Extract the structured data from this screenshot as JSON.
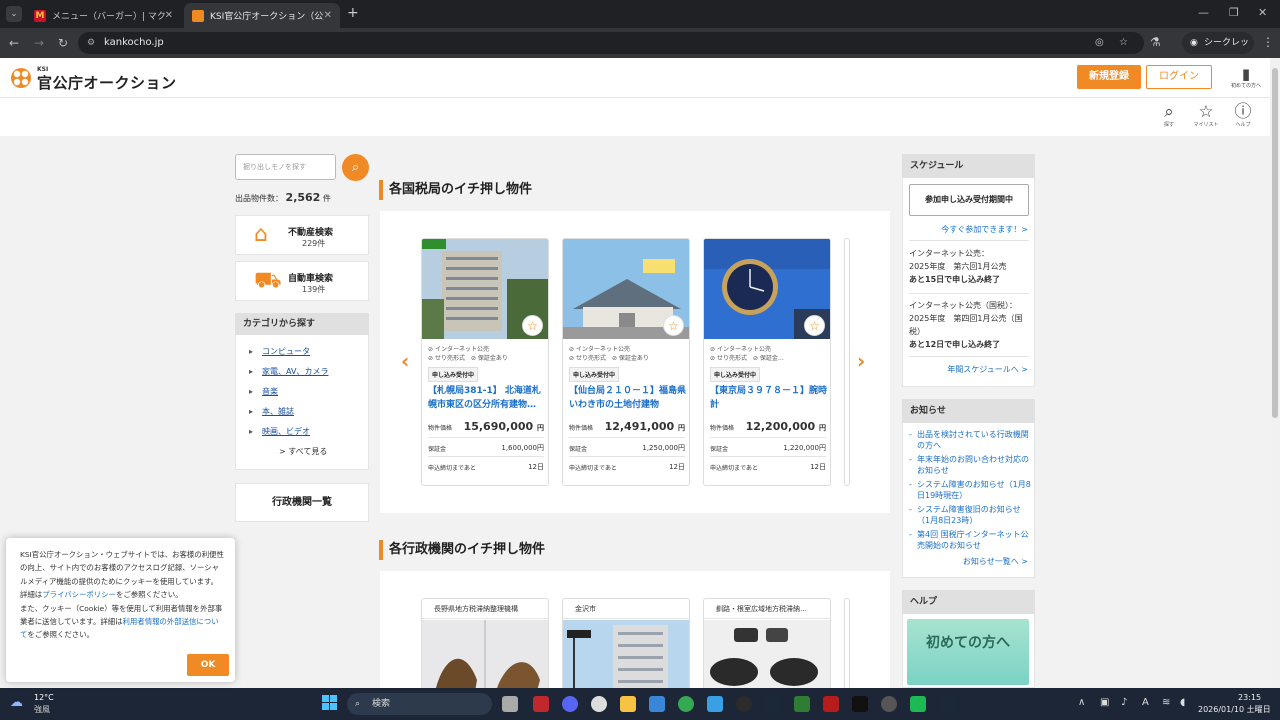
{
  "browser": {
    "tabs": [
      {
        "title": "メニュー（バーガー）| マクドナルド公式",
        "active": false
      },
      {
        "title": "KSI官公庁オークション（公売・公有...",
        "active": true
      }
    ],
    "url": "kankocho.jp",
    "incognito_label": "シークレット"
  },
  "header": {
    "logo_small": "KSI",
    "logo_text": "官公庁オークション",
    "register": "新規登録",
    "login": "ログイン",
    "beginner": "初めての方へ",
    "icons": [
      {
        "label": "探す",
        "icon": "search-icon"
      },
      {
        "label": "マイリスト",
        "icon": "star-icon"
      },
      {
        "label": "ヘルプ",
        "icon": "help-icon"
      }
    ]
  },
  "left": {
    "search_placeholder": "掘り出しモノを探す",
    "count_label": "出品物件数：",
    "count_value": "2,562",
    "count_unit": "件",
    "realestate": {
      "title": "不動産検索",
      "count": "229件"
    },
    "car": {
      "title": "自動車検索",
      "count": "139件"
    },
    "category_head": "カテゴリから探す",
    "categories": [
      "コンピュータ",
      "家電、AV、カメラ",
      "音楽",
      "本、雑誌",
      "映画、ビデオ"
    ],
    "see_all": "> すべて見る",
    "gov_list": "行政機関一覧"
  },
  "center": {
    "section1_title": "各国税局のイチ押し物件",
    "section2_title": "各行政機関のイチ押し物件",
    "labels": {
      "price": "物件価格",
      "deposit": "保証金",
      "deadline": "申込締切まであと",
      "yen": "円"
    },
    "cards": [
      {
        "tag1": "インターネット公売",
        "tag2": "せり売形式",
        "tag3": "保証金あり",
        "badge": "申し込み受付中",
        "name": "【札幌局381-1】 北海道札幌市東区の区分所有建物…",
        "price": "15,690,000",
        "deposit": "1,600,000円",
        "deadline": "12日"
      },
      {
        "tag1": "インターネット公売",
        "tag2": "せり売形式",
        "tag3": "保証金あり",
        "badge": "申し込み受付中",
        "name": "【仙台局２１０－１】福島県いわき市の土地付建物",
        "price": "12,491,000",
        "deposit": "1,250,000円",
        "deadline": "12日"
      },
      {
        "tag1": "インターネット公売",
        "tag2": "せり売形式",
        "tag3": "保証金…",
        "badge": "申し込み受付中",
        "name": "【東京局３９７８－１】腕時計",
        "price": "12,200,000",
        "deposit": "1,220,000円",
        "deadline": "12日"
      }
    ],
    "cards2": [
      "長野県地方税滞納整理機構",
      "金沢市",
      "釧路・根室広域地方税滞納…"
    ]
  },
  "right": {
    "schedule_head": "スケジュール",
    "join_button": "参加申し込み受付期間中",
    "join_link": "今すぐ参加できます！>",
    "s1_line1": "インターネット公売：",
    "s1_line2": "2025年度　第六回1月公売",
    "s1_line3": "あと15日で申し込み終了",
    "s2_line1": "インターネット公売（国税）：",
    "s2_line2": "2025年度　第四回1月公売（国税）",
    "s2_line3": "あと12日で申し込み終了",
    "yearly_link": "年間スケジュールへ >",
    "news_head": "お知らせ",
    "news": [
      "出品を検討されている行政機関の方へ",
      "年末年始のお問い合わせ対応のお知らせ",
      "システム障害のお知らせ（1月8日19時現在）",
      "システム障害復旧のお知らせ（1月8日23時）",
      "第4回 国税庁インターネット公売開始のお知らせ"
    ],
    "news_link": "お知らせ一覧へ >",
    "help_head": "ヘルプ",
    "help_banner": "初めての方へ"
  },
  "cookie": {
    "text1": "KSI官公庁オークション・ウェブサイトでは、お客様の利便性の向上、サイト内でのお客様のアクセスログ記録、ソーシャルメディア機能の提供のためにクッキーを使用しています。詳細は",
    "link1": "プライバシーポリシー",
    "text2": "をご参照ください。",
    "text3": "また、クッキー（Cookie）等を使用して利用者情報を外部事業者に送信しています。詳細は",
    "link2": "利用者情報の外部送信について",
    "text4": "をご参照ください。",
    "ok": "OK"
  },
  "taskbar": {
    "weather_temp": "12°C",
    "weather_text": "強風",
    "search": "検索",
    "time": "23:15",
    "date": "2026/01/10 土曜日"
  },
  "colors": {
    "accent": "#f08a24",
    "link": "#1a6fc9"
  }
}
